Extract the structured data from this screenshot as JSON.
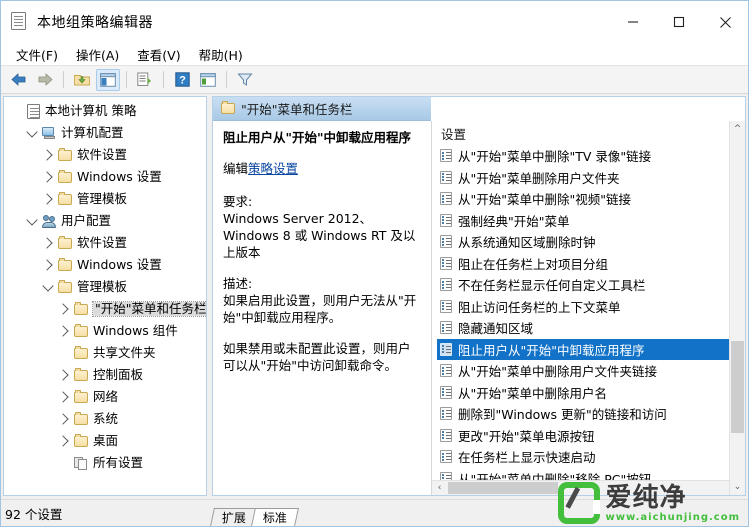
{
  "window": {
    "title": "本地组策略编辑器",
    "icon": "document-icon",
    "buttons": {
      "minimize": "minimize-icon",
      "maximize": "maximize-icon",
      "close": "close-icon"
    }
  },
  "menubar": {
    "items": [
      {
        "label": "文件(F)",
        "name": "menu-file"
      },
      {
        "label": "操作(A)",
        "name": "menu-action"
      },
      {
        "label": "查看(V)",
        "name": "menu-view"
      },
      {
        "label": "帮助(H)",
        "name": "menu-help"
      }
    ]
  },
  "toolbar": {
    "buttons": [
      {
        "name": "back-button",
        "icon": "arrow-left-icon"
      },
      {
        "name": "forward-button",
        "icon": "arrow-right-icon"
      },
      {
        "name": "up-folder-button",
        "icon": "folder-up-icon"
      },
      {
        "name": "show-hide-tree-button",
        "icon": "window-pane-icon",
        "selected": true
      },
      {
        "name": "export-list-button",
        "icon": "export-list-icon"
      },
      {
        "name": "help-button",
        "icon": "question-mark-icon"
      },
      {
        "name": "show-details-button",
        "icon": "details-pane-icon"
      },
      {
        "name": "filter-button",
        "icon": "funnel-icon"
      }
    ]
  },
  "tree": {
    "nodes": [
      {
        "label": "本地计算机 策略",
        "icon": "policy-root-icon",
        "indent": 0,
        "twist": "none",
        "selected": false
      },
      {
        "label": "计算机配置",
        "icon": "computer-icon",
        "indent": 1,
        "twist": "down",
        "selected": false
      },
      {
        "label": "软件设置",
        "icon": "folder-icon",
        "indent": 2,
        "twist": "right",
        "selected": false
      },
      {
        "label": "Windows 设置",
        "icon": "folder-icon",
        "indent": 2,
        "twist": "right",
        "selected": false
      },
      {
        "label": "管理模板",
        "icon": "folder-icon",
        "indent": 2,
        "twist": "right",
        "selected": false
      },
      {
        "label": "用户配置",
        "icon": "users-icon",
        "indent": 1,
        "twist": "down",
        "selected": false
      },
      {
        "label": "软件设置",
        "icon": "folder-icon",
        "indent": 2,
        "twist": "right",
        "selected": false
      },
      {
        "label": "Windows 设置",
        "icon": "folder-icon",
        "indent": 2,
        "twist": "right",
        "selected": false
      },
      {
        "label": "管理模板",
        "icon": "folder-icon",
        "indent": 2,
        "twist": "down",
        "selected": false
      },
      {
        "label": "\"开始\"菜单和任务栏",
        "icon": "folder-icon",
        "indent": 3,
        "twist": "right",
        "selected": true
      },
      {
        "label": "Windows 组件",
        "icon": "folder-icon",
        "indent": 3,
        "twist": "right",
        "selected": false
      },
      {
        "label": "共享文件夹",
        "icon": "folder-icon",
        "indent": 3,
        "twist": "none",
        "selected": false
      },
      {
        "label": "控制面板",
        "icon": "folder-icon",
        "indent": 3,
        "twist": "right",
        "selected": false
      },
      {
        "label": "网络",
        "icon": "folder-icon",
        "indent": 3,
        "twist": "right",
        "selected": false
      },
      {
        "label": "系统",
        "icon": "folder-icon",
        "indent": 3,
        "twist": "right",
        "selected": false
      },
      {
        "label": "桌面",
        "icon": "folder-icon",
        "indent": 3,
        "twist": "right",
        "selected": false
      },
      {
        "label": "所有设置",
        "icon": "all-settings-icon",
        "indent": 3,
        "twist": "none",
        "selected": false
      }
    ]
  },
  "pane_header": {
    "icon": "folder-icon",
    "title": "\"开始\"菜单和任务栏"
  },
  "detail": {
    "title": "阻止用户从\"开始\"中卸载应用程序",
    "edit_prefix": "编辑",
    "edit_link": "策略设置",
    "requirement_label": "要求:",
    "requirement_text": "Windows Server 2012、Windows 8 或 Windows RT 及以上版本",
    "description_label": "描述:",
    "description_p1": "如果启用此设置，则用户无法从\"开始\"中卸载应用程序。",
    "description_p2": "如果禁用或未配置此设置，则用户可以从\"开始\"中访问卸载命令。"
  },
  "list": {
    "header": "设置",
    "items": [
      {
        "label": "从\"开始\"菜单中删除\"TV 录像\"链接",
        "selected": false
      },
      {
        "label": "从\"开始\"菜单删除用户文件夹",
        "selected": false
      },
      {
        "label": "从\"开始\"菜单中删除\"视频\"链接",
        "selected": false
      },
      {
        "label": "强制经典\"开始\"菜单",
        "selected": false
      },
      {
        "label": "从系统通知区域删除时钟",
        "selected": false
      },
      {
        "label": "阻止在任务栏上对项目分组",
        "selected": false
      },
      {
        "label": "不在任务栏显示任何自定义工具栏",
        "selected": false
      },
      {
        "label": "阻止访问任务栏的上下文菜单",
        "selected": false
      },
      {
        "label": "隐藏通知区域",
        "selected": false
      },
      {
        "label": "阻止用户从\"开始\"中卸载应用程序",
        "selected": true
      },
      {
        "label": "从\"开始\"菜单中删除用户文件夹链接",
        "selected": false
      },
      {
        "label": "从\"开始\"菜单中删除用户名",
        "selected": false
      },
      {
        "label": "删除到\"Windows 更新\"的链接和访问",
        "selected": false
      },
      {
        "label": "更改\"开始\"菜单电源按钮",
        "selected": false
      },
      {
        "label": "在任务栏上显示快速启动",
        "selected": false
      },
      {
        "label": "从\"开始\"菜单中删除\"移除 PC\"按钮",
        "selected": false
      }
    ],
    "scroll": {
      "up_arrow": "chevron-up-icon",
      "down_arrow": "chevron-down-icon",
      "left_arrow": "chevron-left-icon"
    }
  },
  "tabs": [
    {
      "label": "扩展",
      "active": false,
      "name": "tab-extended"
    },
    {
      "label": "标准",
      "active": true,
      "name": "tab-standard"
    }
  ],
  "statusbar": {
    "text": "92 个设置"
  },
  "watermark": {
    "brand": "爱纯净",
    "url": "www.aichunjing.com",
    "accent": "#43bf3d"
  }
}
